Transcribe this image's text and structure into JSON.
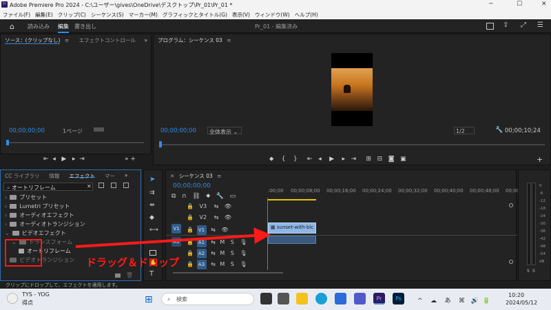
{
  "titlebar": {
    "title": "Adobe Premiere Pro 2024 - C:\\ユーザー\\gives\\OneDrive\\デスクトップ\\Pr_01\\Pr_01 *",
    "minimize": "─",
    "maximize": "☐",
    "close": "✕",
    "app_badge": "Pr"
  },
  "menu": [
    "ファイル(F)",
    "編集(E)",
    "クリップ(C)",
    "シーケンス(S)",
    "マーカー(M)",
    "グラフィックとタイトル(G)",
    "表示(V)",
    "ウィンドウ(W)",
    "ヘルプ(H)"
  ],
  "workspace": {
    "tabs": [
      "読み込み",
      "編集",
      "書き出し"
    ],
    "active": "編集",
    "project_title": "Pr_01 - 編集済み"
  },
  "source_panel": {
    "tab1": "ソース：(クリップなし)",
    "tab2": "エフェクトコントロール",
    "timecode": "00;00;00;00",
    "page": "1ページ"
  },
  "program_panel": {
    "tab": "プログラム：シーケンス 03",
    "timecode": "00;00;00;00",
    "fit": "全体表示",
    "ratio": "1/2",
    "duration": "00;00;10;24"
  },
  "effects_panel": {
    "tabs": [
      "CC ライブラリ",
      "情報",
      "エフェクト",
      "マー"
    ],
    "search_value": "オートリフレーム",
    "items": [
      "プリセット",
      "Lumetri プリセット",
      "オーディオエフェクト",
      "オーディオトランジション",
      "ビデオエフェクト",
      "トランスフォーム",
      "オートリフレーム",
      "ビデオトランジション"
    ]
  },
  "timeline": {
    "tab": "シーケンス 03",
    "timecode": "00;00;00;00",
    "ruler": [
      ":00;00",
      "00;00;08;00",
      "00;00;16;00",
      "00;00;24;00",
      "00;00;32;00",
      "00;00;40;00",
      "00;00;48;00",
      "00;00"
    ],
    "video_tracks": [
      "V3",
      "V2",
      "V1"
    ],
    "audio_tracks": [
      "A1",
      "A2",
      "A3"
    ],
    "source_patch": [
      "V1",
      "A1"
    ],
    "clip_name": "sunset-with-bic",
    "mute": "M",
    "solo": "S"
  },
  "annotation": {
    "label": "ドラッグ＆ドロップ",
    "color": "#ff1a1a"
  },
  "meter": {
    "labels": [
      "0",
      "-6",
      "-12",
      "-18",
      "-24",
      "-30",
      "-36",
      "-42",
      "-48",
      "-54",
      "dB"
    ],
    "s1": "S",
    "s2": "S"
  },
  "status_bar": "クリップにドロップして、エフェクトを適用します。",
  "taskbar": {
    "notification_title": "TYS - YOG",
    "notification_sub": "得点",
    "search_placeholder": "検索",
    "time": "10:20",
    "date": "2024/05/12",
    "tray": [
      "^",
      "☁",
      "あ",
      "⌘",
      "🔊",
      "🔋"
    ]
  }
}
